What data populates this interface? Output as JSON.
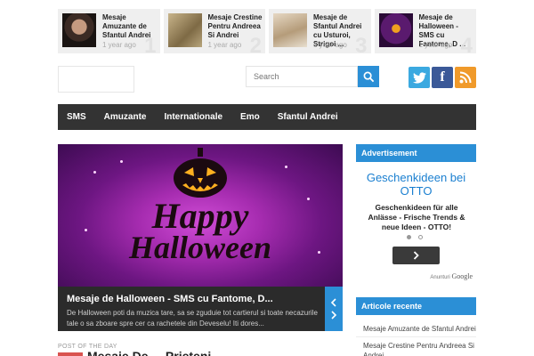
{
  "recent_strip": [
    {
      "title": "Mesaje Amuzante de Sfantul Andrei",
      "ago": "1 year ago",
      "number": "1"
    },
    {
      "title": "Mesaje Crestine Pentru Andreea Si Andrei",
      "ago": "1 year ago",
      "number": "2"
    },
    {
      "title": "Mesaje de Sfantul Andrei cu Usturoi, Strigoi ...",
      "ago": "1 year ago",
      "number": "3"
    },
    {
      "title": "Mesaje de Halloween - SMS cu Fantome, D ...",
      "ago": "1 year ago",
      "number": "4"
    }
  ],
  "search": {
    "placeholder": "Search"
  },
  "social": {
    "facebook_letter": "f"
  },
  "nav": [
    "SMS",
    "Amuzante",
    "Internationale",
    "Emo",
    "Sfantul Andrei"
  ],
  "slider": {
    "title": "Mesaje de Halloween - SMS cu Fantome, D...",
    "excerpt": "De Halloween poti da muzica tare, sa se zguduie tot cartierul si toate necazurile tale o sa zboare spre cer ca rachetele din Deveselu! Iti dores...",
    "image_text_top": "Happy",
    "image_text_bottom": "Halloween"
  },
  "post_of_day": {
    "label": "POST OF THE DAY",
    "title": "Mesaje De ... Prieteni ..."
  },
  "sidebar": {
    "ad_header": "Advertisement",
    "ad_title": "Geschenkideen bei OTTO",
    "ad_text": "Geschenkideen für alle Anlässe - Frische Trends & neue Ideen - OTTO!",
    "ad_by": "Anunturi",
    "ad_google": "Google",
    "recent_header": "Articole recente",
    "recent": [
      "Mesaje Amuzante de Sfantul Andrei",
      "Mesaje Crestine Pentru Andreea Si Andrei"
    ]
  },
  "colors": {
    "accent": "#2b8fd6",
    "nav_bg": "#333333",
    "caption_bg": "#2b2b2b"
  }
}
